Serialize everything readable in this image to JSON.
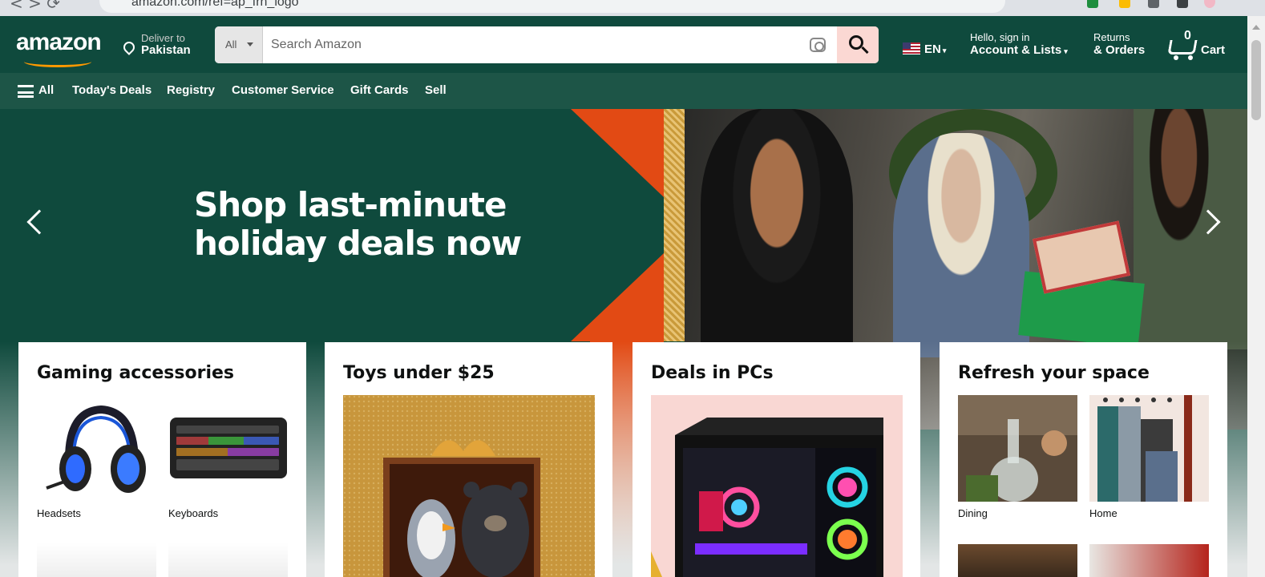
{
  "browser": {
    "url": "amazon.com/ref=ap_frn_logo"
  },
  "header": {
    "logo": "amazon",
    "deliver_line1": "Deliver to",
    "deliver_line2": "Pakistan",
    "search_category": "All",
    "search_placeholder": "Search Amazon",
    "language": "EN",
    "account_line1": "Hello, sign in",
    "account_line2": "Account & Lists",
    "returns_line1": "Returns",
    "returns_line2": "& Orders",
    "cart_count": "0",
    "cart_label": "Cart"
  },
  "subnav": {
    "all_label": "All",
    "items": [
      "Today's Deals",
      "Registry",
      "Customer Service",
      "Gift Cards",
      "Sell"
    ]
  },
  "hero": {
    "line1": "Shop last-minute",
    "line2": "holiday deals now"
  },
  "cards": [
    {
      "title": "Gaming accessories",
      "tiles": [
        {
          "label": "Headsets"
        },
        {
          "label": "Keyboards"
        }
      ]
    },
    {
      "title": "Toys under $25"
    },
    {
      "title": "Deals in PCs"
    },
    {
      "title": "Refresh your space",
      "tiles": [
        {
          "label": "Dining"
        },
        {
          "label": "Home"
        }
      ]
    }
  ],
  "colors": {
    "header_bg": "#0f4a3d",
    "subnav_bg": "#1d5547",
    "accent": "#e24a14",
    "search_button": "#fbd8d3"
  }
}
